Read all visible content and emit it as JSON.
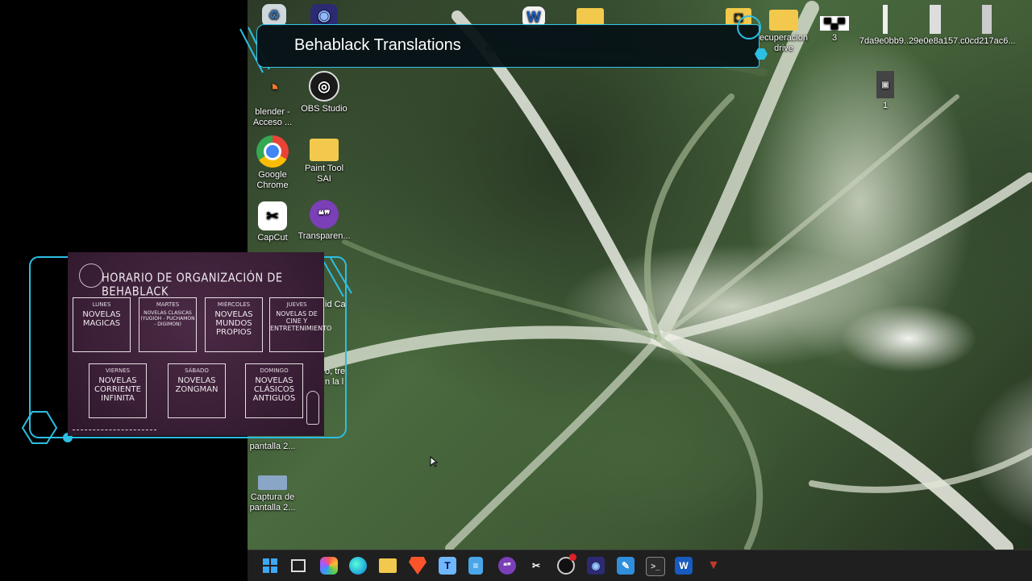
{
  "banner": {
    "title": "Behablack Translations"
  },
  "desktop_icons": {
    "blender": "blender - Acceso ...",
    "obs": "OBS Studio",
    "chrome": "Google Chrome",
    "paint_tool_sai": "Paint Tool SAI",
    "capcut": "CapCut",
    "transparent": "Transparen...",
    "recuperacion_drive": "ecuperacion drive",
    "img_3": "3",
    "img_7da9": "7da9e0bb9...",
    "img_29e0": "29e0e8a157...",
    "img_c0cd": "c0cd217ac6...",
    "img_1": "1",
    "captura_1": "pantalla 2...",
    "captura_2": "Captura de pantalla 2...",
    "partial_a": "id Ca",
    "partial_b": "o, tre",
    "partial_c": "n la l"
  },
  "schedule": {
    "title": "HORARIO DE ORGANIZACIÓN DE BEHABLACK",
    "days": [
      {
        "day": "LUNES",
        "category": "NOVELAS MAGICAS"
      },
      {
        "day": "MARTES",
        "category": "NOVELAS CLASICAS (YUGIOH - PUCHAMON - DIGIMON)"
      },
      {
        "day": "MIÉRCOLES",
        "category": "NOVELAS MUNDOS PROPIOS"
      },
      {
        "day": "JUEVES",
        "category": "NOVELAS DE CINE Y ENTRETENIMIENTO"
      },
      {
        "day": "VIERNES",
        "category": "NOVELAS CORRIENTE INFINITA"
      },
      {
        "day": "SÁBADO",
        "category": "NOVELAS ZONGMAN"
      },
      {
        "day": "DOMINGO",
        "category": "NOVELAS CLÁSICOS ANTIGUOS"
      }
    ]
  },
  "colors": {
    "accent": "#2bbfe3",
    "chalkboard": "#3a1f36",
    "taskbar": "#1f1f1f"
  },
  "taskbar_icons": [
    "windows-start-icon",
    "task-view-icon",
    "copilot-icon",
    "edge-icon",
    "file-explorer-icon",
    "brave-icon",
    "translator-icon",
    "notepad-icon",
    "transparent-chat-icon",
    "capcut-icon",
    "obs-icon",
    "app-icon",
    "paint-icon",
    "terminal-icon",
    "word-icon",
    "app-v-icon"
  ]
}
